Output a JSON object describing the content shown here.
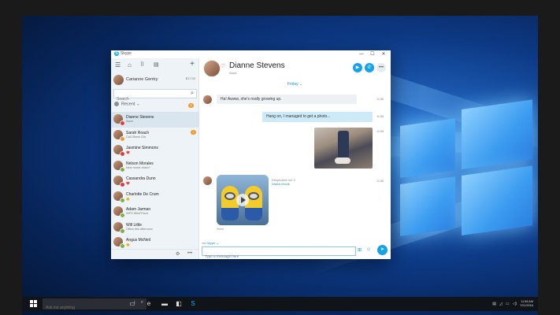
{
  "window": {
    "app_title": "Skype",
    "controls": [
      "—",
      "☐",
      "✕"
    ]
  },
  "sidebar": {
    "profile": {
      "name": "Carianne Gentry",
      "credit": "$17.00"
    },
    "search_placeholder": "Search",
    "recent_label": "Recent ⌄",
    "recent_badge": "2",
    "contacts": [
      {
        "name": "Dianne Stevens",
        "mood": "Aww!",
        "status_color": "#e53935",
        "active": true
      },
      {
        "name": "Sarah Roach",
        "mood": "Call 26min 23s",
        "status_color": "#f29a2e",
        "badge": "1"
      },
      {
        "name": "Jasmine Simmons",
        "mood": "❤️",
        "status_color": "#e53935"
      },
      {
        "name": "Nelson Morales",
        "mood": "New music video?",
        "status_color": "#7cb342"
      },
      {
        "name": "Cassandra Dunn",
        "mood": "❤️",
        "status_color": "#e53935"
      },
      {
        "name": "Charlotte De Crum",
        "mood": "😊",
        "status_color": "#7cb342"
      },
      {
        "name": "Adam Jarman",
        "mood": "WFH Wed/Thurs",
        "status_color": "#7cb342"
      },
      {
        "name": "Will Little",
        "mood": "Office this afternoon",
        "status_color": "#7cb342"
      },
      {
        "name": "Angus McNeil",
        "mood": "😊",
        "status_color": "#7cb342"
      }
    ]
  },
  "chat": {
    "contact_name": "Dianne Stevens",
    "contact_mood": "Aww!",
    "day_label": "Friday ⌄",
    "messages": [
      {
        "text": "Ha! Awww, she's really growing up.",
        "time": "11:56"
      },
      {
        "text": "Hang on, I managed to get a photo...",
        "time": "11:56"
      },
      {
        "time": "11:56"
      },
      {
        "time": "11:56",
        "caption": "Despicable me 2",
        "link": "Watch Movie"
      }
    ],
    "gif_sender": "Seen",
    "via_label": "via",
    "via_value": "Skype ⌄",
    "compose_placeholder": "Type a message here"
  },
  "taskbar": {
    "search_placeholder": "Ask me anything",
    "time": "11:56 AM",
    "date": "7/21/2016"
  }
}
